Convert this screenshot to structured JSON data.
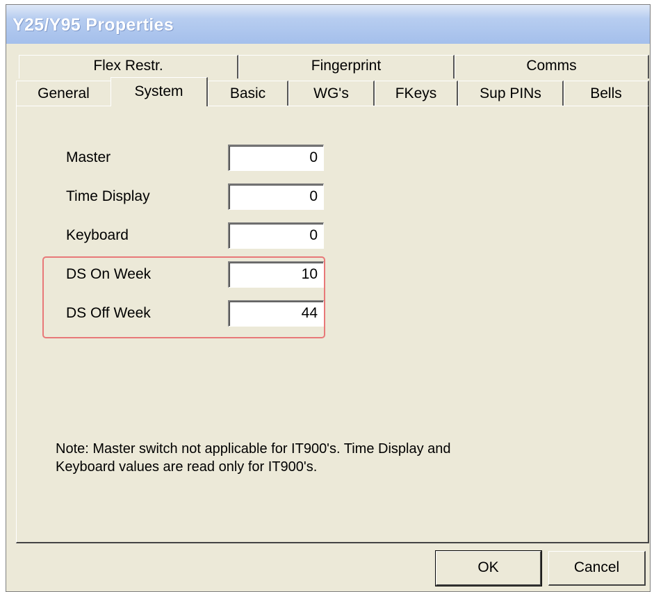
{
  "window": {
    "title": "Y25/Y95 Properties"
  },
  "tabs_back": [
    {
      "label": "Flex Restr."
    },
    {
      "label": "Fingerprint"
    },
    {
      "label": "Comms"
    }
  ],
  "tabs_front": [
    {
      "label": "General"
    },
    {
      "label": "System",
      "selected": true
    },
    {
      "label": "Basic"
    },
    {
      "label": "WG's"
    },
    {
      "label": "FKeys"
    },
    {
      "label": "Sup PINs"
    },
    {
      "label": "Bells"
    }
  ],
  "fields": [
    {
      "label": "Master",
      "value": "0"
    },
    {
      "label": "Time Display",
      "value": "0"
    },
    {
      "label": "Keyboard",
      "value": "0"
    },
    {
      "label": "DS On Week",
      "value": "10"
    },
    {
      "label": "DS Off Week",
      "value": "44"
    }
  ],
  "note": {
    "line1": "Note: Master switch not applicable for IT900's.  Time Display and",
    "line2": "Keyboard values are read only for IT900's."
  },
  "buttons": {
    "ok": "OK",
    "cancel": "Cancel"
  },
  "colors": {
    "highlight_border": "#e87878",
    "dialog_bg": "#ece9d8",
    "title_gradient": "#a4bfeb"
  }
}
